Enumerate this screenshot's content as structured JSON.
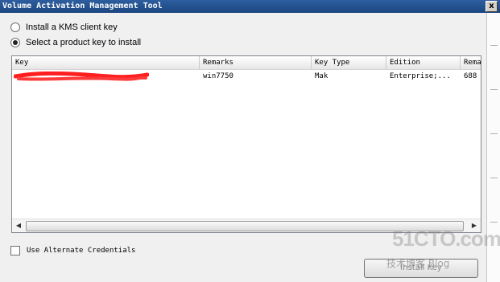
{
  "window": {
    "title": "Volume Activation Management Tool",
    "close_label": "x"
  },
  "options": [
    {
      "label": "Install a KMS client key",
      "selected": false
    },
    {
      "label": "Select a product key to install",
      "selected": true
    }
  ],
  "table": {
    "columns": [
      "Key",
      "Remarks",
      "Key Type",
      "Edition",
      "Rema"
    ],
    "rows": [
      {
        "key": "",
        "remarks": "win7750",
        "key_type": "Mak",
        "edition": "Enterprise;...",
        "remaining": "688"
      }
    ]
  },
  "scrollbar": {
    "left_arrow": "◀",
    "right_arrow": "▶"
  },
  "alternate_credentials": {
    "label": "Use Alternate Credentials",
    "checked": false
  },
  "action_button": {
    "label": "Install Key"
  },
  "watermark": {
    "brand": "51CTO.com",
    "subtitle": "技术博客",
    "blog": "Blog"
  },
  "colors": {
    "title_bar": "#1b4680",
    "redaction": "#ff1f1f"
  }
}
